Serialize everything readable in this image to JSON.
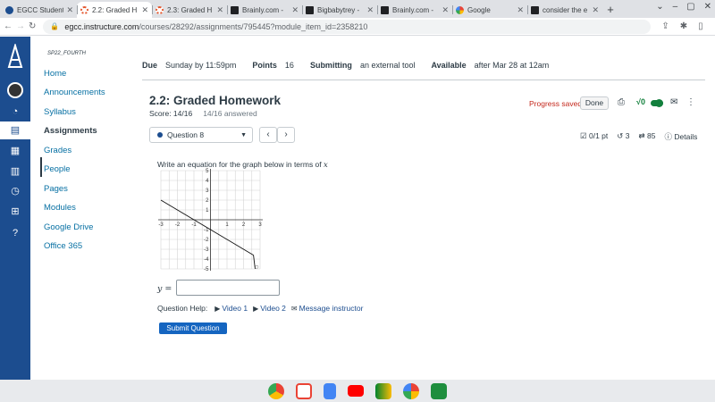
{
  "browser": {
    "tabs": [
      {
        "title": "EGCC Student",
        "color": "#1c4d8f",
        "active": false
      },
      {
        "title": "2.2: Graded H",
        "color": "#e4572e",
        "active": true
      },
      {
        "title": "2.3: Graded H",
        "color": "#e4572e",
        "active": false
      },
      {
        "title": "Brainly.com -",
        "color": "#202124",
        "active": false
      },
      {
        "title": "Bigbabytrey -",
        "color": "#202124",
        "active": false
      },
      {
        "title": "Brainly.com -",
        "color": "#202124",
        "active": false
      },
      {
        "title": "Google",
        "color": "#4285f4",
        "active": false
      },
      {
        "title": "consider the e",
        "color": "#202124",
        "active": false
      }
    ],
    "url_host": "egcc.instructure.com",
    "url_path": "/courses/28292/assignments/795445?module_item_id=2358210"
  },
  "course": {
    "name": "SP22_FOURTH",
    "nav": [
      "Home",
      "Announcements",
      "Syllabus",
      "Assignments",
      "Grades",
      "People",
      "Pages",
      "Modules",
      "Google Drive",
      "Office 365"
    ],
    "current": "Assignments"
  },
  "assignment": {
    "due_label": "Due",
    "due_value": "Sunday by 11:59pm",
    "points_label": "Points",
    "points_value": "16",
    "submitting_label": "Submitting",
    "submitting_value": "an external tool",
    "available_label": "Available",
    "available_value": "after Mar 28 at 12am"
  },
  "homework": {
    "title": "2.2: Graded Homework",
    "score": "Score: 14/16",
    "answered": "14/16 answered",
    "progress_saved": "Progress saved",
    "done": "Done",
    "sqrt_label": "√0",
    "question_select": "Question 8",
    "prev_arrow": "‹",
    "next_arrow": "›",
    "points": "0/1 pt",
    "retries": "3",
    "attempts": "85",
    "details": "Details"
  },
  "question": {
    "prompt": "Write an equation for the graph below in terms of",
    "variable": "x",
    "y_label": "y =",
    "answer_value": "",
    "help_label": "Question Help:",
    "video1": "Video 1",
    "video2": "Video 2",
    "message": "Message instructor",
    "submit": "Submit Question"
  },
  "graph": {
    "x_ticks": [
      "-3",
      "-2",
      "-1",
      "1",
      "2",
      "3"
    ],
    "y_ticks": [
      "5",
      "4",
      "3",
      "2",
      "1",
      "-1",
      "-2",
      "-3",
      "-4",
      "-5"
    ],
    "xlim": [
      -3,
      3
    ],
    "ylim": [
      -5,
      5
    ]
  }
}
